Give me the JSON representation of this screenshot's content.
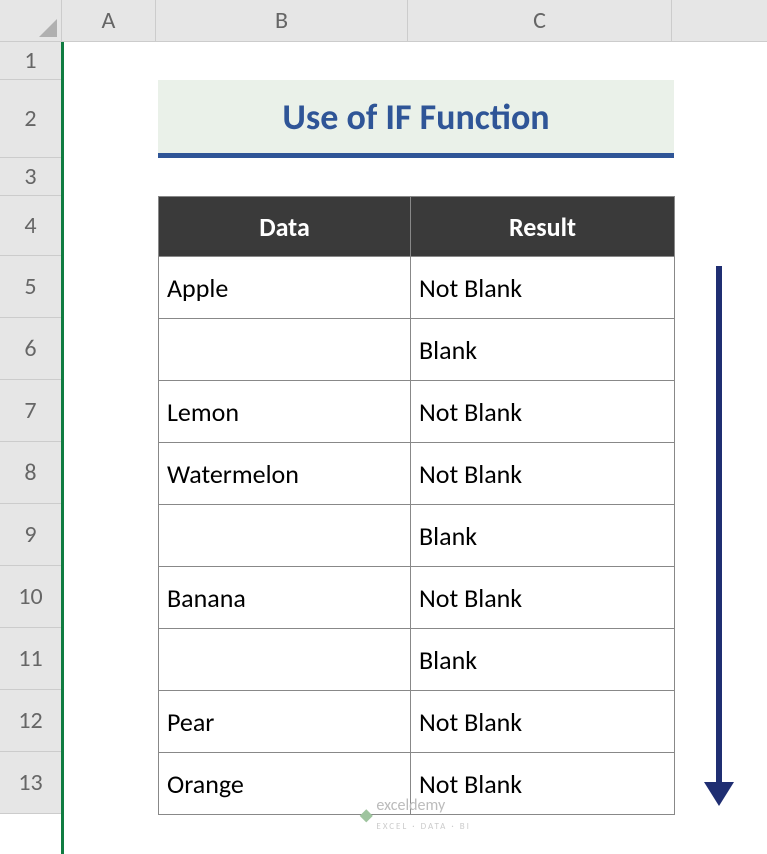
{
  "columns": {
    "A": 94,
    "B": 252,
    "C": 264
  },
  "rows": {
    "heights": [
      38,
      78,
      38,
      60,
      62,
      62,
      62,
      62,
      62,
      62,
      62,
      62,
      62
    ],
    "labels": [
      "1",
      "2",
      "3",
      "4",
      "5",
      "6",
      "7",
      "8",
      "9",
      "10",
      "11",
      "12",
      "13"
    ]
  },
  "title": "Use of IF Function",
  "table": {
    "headers": [
      "Data",
      "Result"
    ],
    "rows": [
      {
        "data": "Apple",
        "result": "Not Blank"
      },
      {
        "data": "",
        "result": "Blank"
      },
      {
        "data": "Lemon",
        "result": "Not Blank"
      },
      {
        "data": "Watermelon",
        "result": "Not Blank"
      },
      {
        "data": "",
        "result": "Blank"
      },
      {
        "data": "Banana",
        "result": "Not Blank"
      },
      {
        "data": "",
        "result": "Blank"
      },
      {
        "data": "Pear",
        "result": "Not Blank"
      },
      {
        "data": "Orange",
        "result": "Not Blank"
      }
    ]
  },
  "watermark": {
    "brand": "exceldemy",
    "tagline": "EXCEL · DATA · BI"
  },
  "chart_data": {
    "type": "table",
    "title": "Use of IF Function",
    "columns": [
      "Data",
      "Result"
    ],
    "rows": [
      [
        "Apple",
        "Not Blank"
      ],
      [
        "",
        "Blank"
      ],
      [
        "Lemon",
        "Not Blank"
      ],
      [
        "Watermelon",
        "Not Blank"
      ],
      [
        "",
        "Blank"
      ],
      [
        "Banana",
        "Not Blank"
      ],
      [
        "",
        "Blank"
      ],
      [
        "Pear",
        "Not Blank"
      ],
      [
        "Orange",
        "Not Blank"
      ]
    ]
  }
}
